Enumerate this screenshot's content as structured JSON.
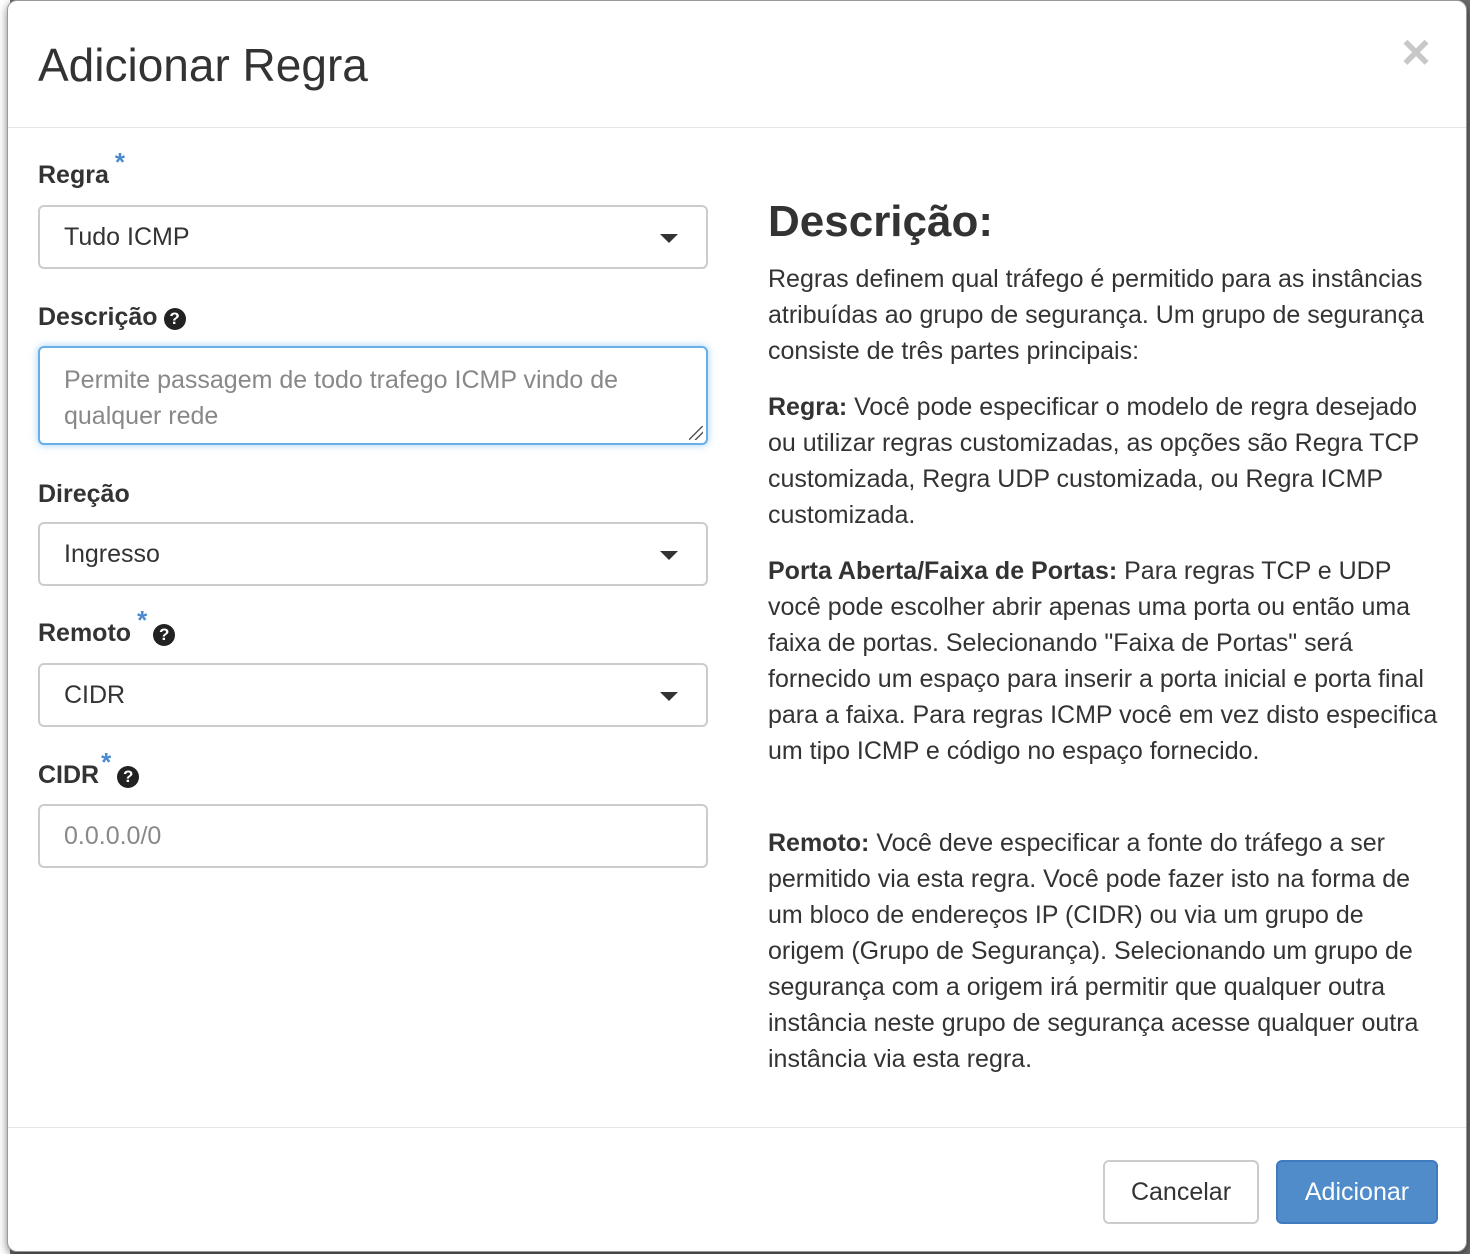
{
  "modal": {
    "title": "Adicionar Regra",
    "close_symbol": "×"
  },
  "form": {
    "rule": {
      "label": "Regra",
      "required_mark": "*",
      "value": "Tudo ICMP"
    },
    "description": {
      "label": "Descrição",
      "help_symbol": "?",
      "placeholder": "Permite passagem de todo trafego ICMP vindo de qualquer rede"
    },
    "direction": {
      "label": "Direção",
      "value": "Ingresso"
    },
    "remote": {
      "label": "Remoto",
      "required_mark": "*",
      "help_symbol": "?",
      "value": "CIDR"
    },
    "cidr": {
      "label": "CIDR",
      "required_mark": "*",
      "help_symbol": "?",
      "placeholder": "0.0.0.0/0"
    }
  },
  "help": {
    "title": "Descrição:",
    "intro": "Regras definem qual tráfego é permitido para as instâncias atribuídas ao grupo de segurança. Um grupo de segurança consiste de três partes principais:",
    "rule_term": "Regra:",
    "rule_text": " Você pode especificar o modelo de regra desejado ou utilizar regras customizadas, as opções são Regra TCP customizada, Regra UDP customizada, ou Regra ICMP customizada.",
    "port_term": "Porta Aberta/Faixa de Portas:",
    "port_text": " Para regras TCP e UDP você pode escolher abrir apenas uma porta ou então uma faixa de portas. Selecionando \"Faixa de Portas\" será fornecido um espaço para inserir a porta inicial e porta final para a faixa. Para regras ICMP você em vez disto especifica um tipo ICMP e código no espaço fornecido.",
    "remote_term": "Remoto:",
    "remote_text": " Você deve especificar a fonte do tráfego a ser permitido via esta regra. Você pode fazer isto na forma de um bloco de endereços IP (CIDR) ou via um grupo de origem (Grupo de Segurança). Selecionando um grupo de segurança com a origem irá permitir que qualquer outra instância neste grupo de segurança acesse qualquer outra instância via esta regra."
  },
  "footer": {
    "cancel_label": "Cancelar",
    "add_label": "Adicionar"
  },
  "colors": {
    "accent": "#4f8cc9",
    "required": "#4a8ad0"
  }
}
